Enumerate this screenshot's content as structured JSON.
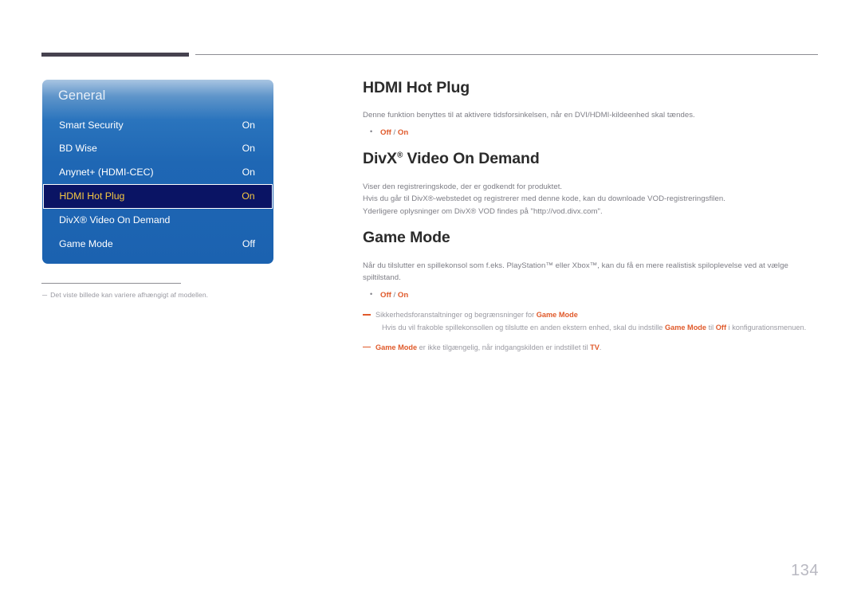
{
  "page": {
    "number": "134"
  },
  "osd": {
    "title": "General",
    "items": [
      {
        "label": "Smart Security",
        "value": "On",
        "selected": false
      },
      {
        "label": "BD Wise",
        "value": "On",
        "selected": false
      },
      {
        "label": "Anynet+ (HDMI-CEC)",
        "value": "On",
        "selected": false
      },
      {
        "label": "HDMI Hot Plug",
        "value": "On",
        "selected": true
      },
      {
        "label": "DivX® Video On Demand",
        "value": "",
        "selected": false
      },
      {
        "label": "Game Mode",
        "value": "Off",
        "selected": false
      }
    ],
    "footnote": {
      "dash": "─",
      "text": "Det viste billede kan variere afhængigt af modellen."
    },
    "colors": {
      "panel_blue": "#1f67b4",
      "panel_highlight_top": "#a9c5e2",
      "selected_bg": "#0a1464",
      "selected_text": "#f5c842"
    }
  },
  "content": {
    "section1": {
      "heading": "HDMI Hot Plug",
      "paragraph": "Denne funktion benyttes til at aktivere tidsforsinkelsen, når en DVI/HDMI-kildeenhed skal tændes.",
      "option_off": "Off",
      "option_sep": " / ",
      "option_on": "On"
    },
    "section2": {
      "heading_main": "DivX",
      "heading_sup": "®",
      "heading_rest": " Video On Demand",
      "paragraph1": "Viser den registreringskode, der er godkendt for produktet.",
      "paragraph2": "Hvis du går til DivX®-webstedet og registrerer med denne kode, kan du downloade VOD-registreringsfilen.",
      "paragraph3": "Yderligere oplysninger om DivX® VOD findes på \"http://vod.divx.com\"."
    },
    "section3": {
      "heading": "Game Mode",
      "paragraph": "Når du tilslutter en spillekonsol som f.eks. PlayStation™ eller Xbox™, kan du få en mere realistisk spiloplevelse ved at vælge spiltilstand.",
      "option_off": "Off",
      "option_sep": " / ",
      "option_on": "On",
      "note1_pre": "Sikkerhedsforanstaltninger og begrænsninger for ",
      "note1_hl": "Game Mode",
      "note1_sub_a": "Hvis du vil frakoble spillekonsollen og tilslutte en anden ekstern enhed, skal du indstille ",
      "note1_sub_hl1": "Game Mode",
      "note1_sub_b": " til ",
      "note1_sub_hl2": "Off",
      "note1_sub_c": " i konfigurationsmenuen.",
      "note2_hl1": "Game Mode",
      "note2_mid": " er ikke tilgængelig, når indgangskilden er indstillet til ",
      "note2_hl2": "TV",
      "note2_end": "."
    }
  },
  "colors": {
    "accent_orange": "#e05a2b",
    "body_gray": "#7d7d85",
    "heading_dark": "#2b2b2b",
    "rule_dark": "#46424f"
  }
}
